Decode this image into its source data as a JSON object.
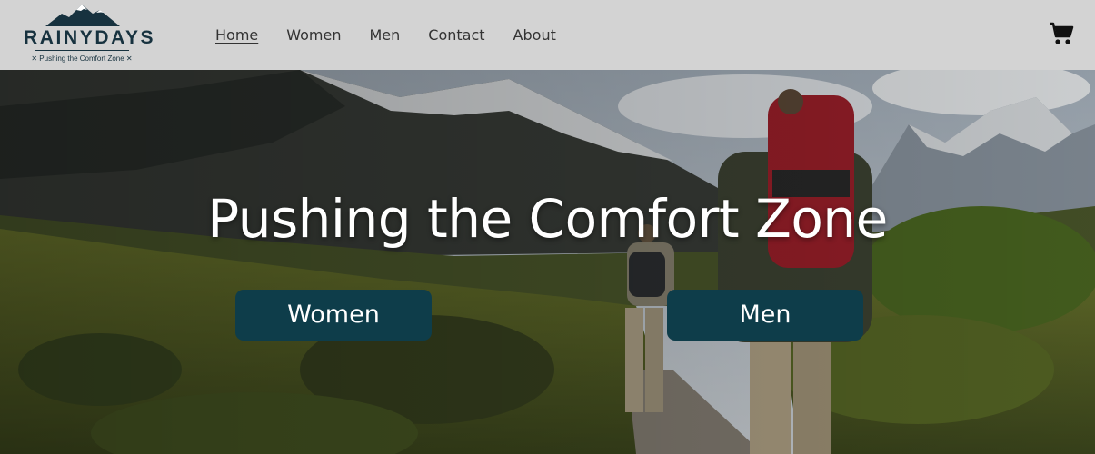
{
  "logo": {
    "brand": "RAINYDAYS",
    "tagline": "✕ Pushing the Comfort Zone ✕"
  },
  "nav": {
    "items": [
      {
        "label": "Home",
        "active": true
      },
      {
        "label": "Women",
        "active": false
      },
      {
        "label": "Men",
        "active": false
      },
      {
        "label": "Contact",
        "active": false
      },
      {
        "label": "About",
        "active": false
      }
    ]
  },
  "header": {
    "cart_icon": "shopping-cart-icon"
  },
  "hero": {
    "title": "Pushing the Comfort Zone",
    "buttons": [
      {
        "label": "Women"
      },
      {
        "label": "Men"
      }
    ]
  },
  "colors": {
    "header_bg": "#d3d3d3",
    "brand_dark": "#17323f",
    "button_bg": "#0e3d4a",
    "hero_text": "#ffffff"
  }
}
